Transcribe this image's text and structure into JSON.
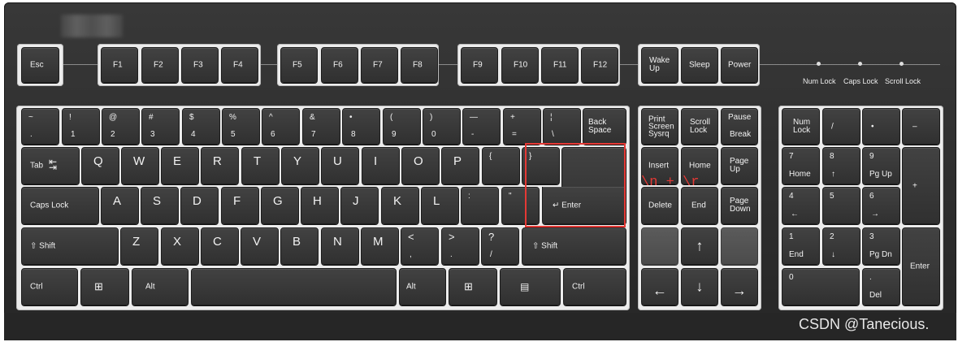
{
  "keys": {
    "esc": "Esc",
    "f": [
      "F1",
      "F2",
      "F3",
      "F4",
      "F5",
      "F6",
      "F7",
      "F8",
      "F9",
      "F10",
      "F11",
      "F12"
    ],
    "wake": "Wake\nUp",
    "sleep": "Sleep",
    "power": "Power",
    "num_row": [
      {
        "t": "~",
        "b": "."
      },
      {
        "t": "!",
        "b": "1"
      },
      {
        "t": "@",
        "b": "2"
      },
      {
        "t": "#",
        "b": "3"
      },
      {
        "t": "$",
        "b": "4"
      },
      {
        "t": "%",
        "b": "5"
      },
      {
        "t": "^",
        "b": "6"
      },
      {
        "t": "&",
        "b": "7"
      },
      {
        "t": "•",
        "b": "8"
      },
      {
        "t": "(",
        "b": "9"
      },
      {
        "t": ")",
        "b": "0"
      },
      {
        "t": "—",
        "b": "-"
      },
      {
        "t": "+",
        "b": "="
      },
      {
        "t": "¦",
        "b": "\\"
      }
    ],
    "backspace": "Back\nSpace",
    "tab": "Tab",
    "row_q": [
      "Q",
      "W",
      "E",
      "R",
      "T",
      "Y",
      "U",
      "I",
      "O",
      "P",
      "{",
      "}"
    ],
    "caps": "Caps Lock",
    "row_a": [
      "A",
      "S",
      "D",
      "F",
      "G",
      "H",
      "J",
      "K",
      "L",
      ":",
      "\""
    ],
    "enter": "Enter",
    "shift": "Shift",
    "row_z": [
      {
        "t": "Z"
      },
      {
        "t": "X"
      },
      {
        "t": "C"
      },
      {
        "t": "V"
      },
      {
        "t": "B"
      },
      {
        "t": "N"
      },
      {
        "t": "M"
      },
      {
        "t": "<",
        "b": ","
      },
      {
        "t": ">",
        "b": "."
      },
      {
        "t": "?",
        "b": "/"
      }
    ],
    "ctrl": "Ctrl",
    "alt": "Alt",
    "nav": {
      "print": "Print\nScreen\nSysrq",
      "scroll": "Scroll\nLock",
      "pause_t": "Pause",
      "pause_b": "Break",
      "insert": "Insert",
      "home": "Home",
      "pgup": "Page\nUp",
      "delete": "Delete",
      "end": "End",
      "pgdn": "Page\nDown"
    },
    "numpad": {
      "numlock": "Num\nLock",
      "slash": "/",
      "star": "•",
      "minus": "–",
      "k7": "7",
      "k7b": "Home",
      "k8": "8",
      "k9": "9",
      "k9b": "Pg Up",
      "plus": "+",
      "k4": "4",
      "k5": "5",
      "k6": "6",
      "k1": "1",
      "k1b": "End",
      "k2": "2",
      "k3": "3",
      "k3b": "Pg Dn",
      "enter": "Enter",
      "k0": "0",
      "dot": ".",
      "del": "Del"
    }
  },
  "indicators": [
    "Num Lock",
    "Caps Lock",
    "Scroll Lock"
  ],
  "annotation": "\\n + \\r",
  "watermark": "CSDN @Tanecious.",
  "colors": {
    "keyboard": "#2f2f2f",
    "key": "#3a3a3a",
    "label": "#f2f2f2",
    "highlight": "#e53935",
    "annotation": "#e53935"
  }
}
